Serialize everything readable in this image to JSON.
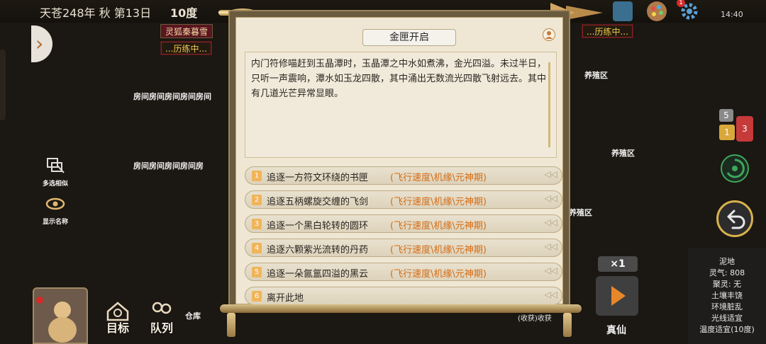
{
  "topbar": {
    "date": "天苍248年 秋 第13日",
    "temperature": "10度",
    "clock": "14:40",
    "notification_count": "1"
  },
  "map": {
    "npc_tag": "灵狐秦暮雪",
    "busy_tags": [
      "...历练中...",
      "...历练中..."
    ],
    "room_rows": [
      "房间房间房间房间房间",
      "房间房间房间房间房"
    ],
    "breeding_areas": [
      "养殖区",
      "养殖区",
      "养殖区"
    ],
    "warehouse": "仓库",
    "harvest": "(收获)收获"
  },
  "left_controls": {
    "multi_select": "多选相似",
    "show_names": "显示名称"
  },
  "bottom_bar": {
    "goal": "目标",
    "queue": "队列"
  },
  "modal": {
    "title": "金匣开启",
    "story": "内门符修喵赶到玉晶潭时，玉晶潭之中水如煮沸，金光四溢。未过半日，只听一声震响，潭水如玉龙四散，其中涌出无数流光四散飞射远去。其中有几道光芒异常显眼。",
    "options": [
      {
        "num": "1",
        "text": "追逐一方符文环绕的书匣",
        "req": "(飞行速度\\机缘\\元神期)"
      },
      {
        "num": "2",
        "text": "追逐五柄螺旋交缠的飞剑",
        "req": "(飞行速度\\机缘\\元神期)"
      },
      {
        "num": "3",
        "text": "追逐一个黑白轮转的圆环",
        "req": "(飞行速度\\机缘\\元神期)"
      },
      {
        "num": "4",
        "text": "追逐六颗紫光流转的丹药",
        "req": "(飞行速度\\机缘\\元神期)"
      },
      {
        "num": "5",
        "text": "追逐一朵氤氲四溢的黑云",
        "req": "(飞行速度\\机缘\\元神期)"
      },
      {
        "num": "6",
        "text": "离开此地",
        "req": ""
      }
    ]
  },
  "side_badges": {
    "grey": "5",
    "yellow": "1",
    "red": "3"
  },
  "speed": "×1",
  "zhenxian": "真仙",
  "tile_info": {
    "terrain": "泥地",
    "lingqi": "灵气: 808",
    "juling": "聚灵: 无",
    "soil": "土壤丰饶",
    "env": "环境脏乱",
    "light": "光线适宜",
    "temp": "温度适宜(10度)"
  }
}
